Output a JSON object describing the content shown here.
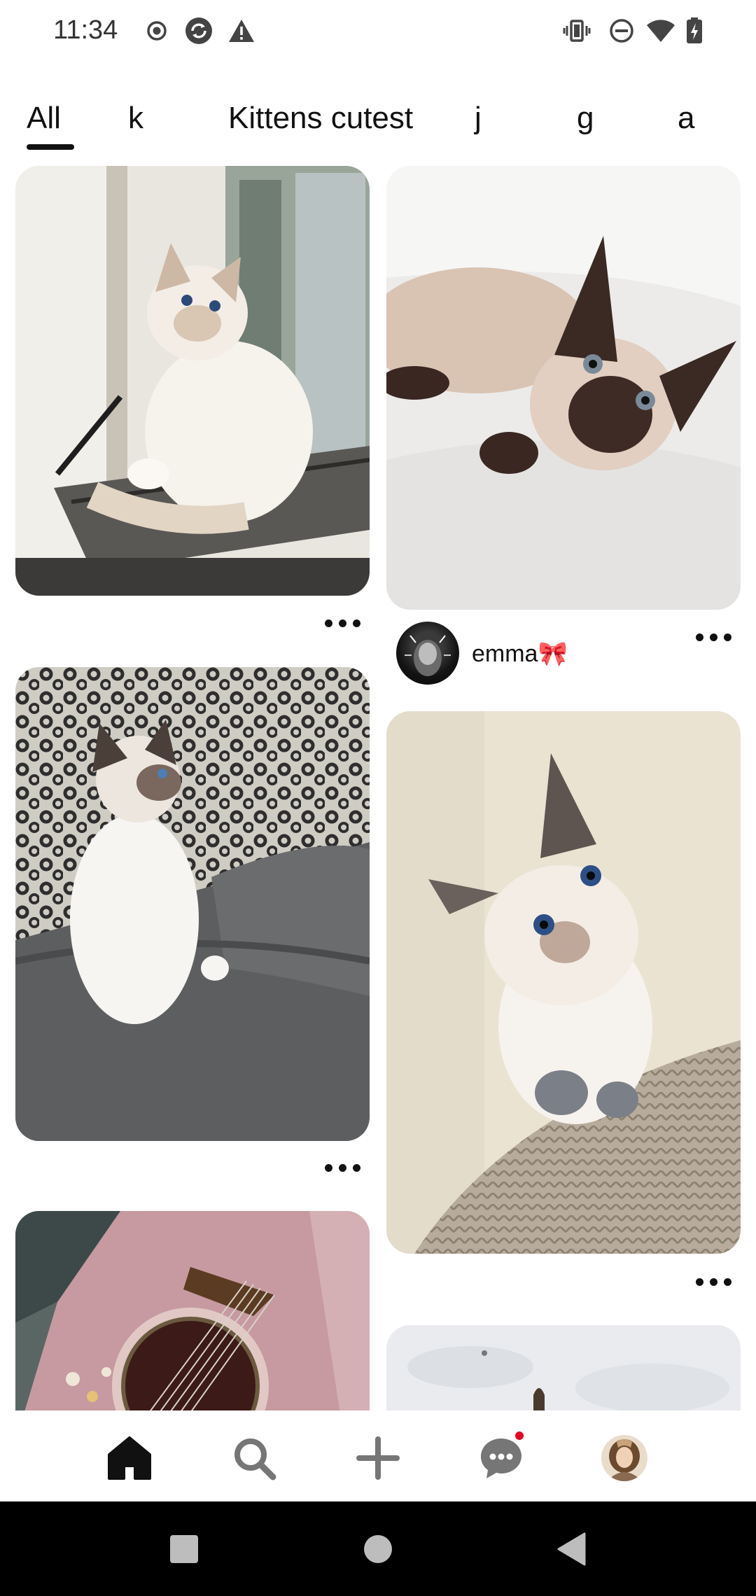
{
  "status_bar": {
    "time": "11:34",
    "left_icons": [
      "record-icon",
      "sync-icon",
      "warning-icon"
    ],
    "right_icons": [
      "vibrate-icon",
      "dnd-icon",
      "wifi-icon",
      "battery-charging-icon"
    ]
  },
  "tabs": {
    "items": [
      {
        "label": "All",
        "selected": true
      },
      {
        "label": "k",
        "selected": false
      },
      {
        "label": "Kittens cutest",
        "selected": false
      },
      {
        "label": "j",
        "selected": false
      },
      {
        "label": "g",
        "selected": false
      },
      {
        "label": "a",
        "selected": false
      }
    ]
  },
  "feed": {
    "pins": [
      {
        "column": "left",
        "subject": "ragdoll cat sitting on window perch",
        "has_more_menu": true
      },
      {
        "column": "right",
        "subject": "siamese kitten lying on white sheet",
        "creator": "emma🎀",
        "has_more_menu": true
      },
      {
        "column": "left",
        "subject": "fluffy kitten on grey couch",
        "has_more_menu": true
      },
      {
        "column": "right",
        "subject": "ragdoll kitten on knitted blanket",
        "has_more_menu": true
      },
      {
        "column": "left",
        "subject": "pink acoustic guitar",
        "has_more_menu": false
      },
      {
        "column": "right",
        "subject": "snowy scene",
        "has_more_menu": false
      }
    ]
  },
  "bottom_nav": {
    "items": [
      {
        "icon": "home-icon",
        "active": true
      },
      {
        "icon": "search-icon",
        "active": false
      },
      {
        "icon": "plus-icon",
        "active": false
      },
      {
        "icon": "messages-icon",
        "active": false,
        "notification_dot": true
      },
      {
        "icon": "profile-avatar",
        "active": false
      }
    ],
    "accent_color": "#e60023"
  },
  "system_nav": {
    "buttons": [
      "recents-square-icon",
      "home-circle-icon",
      "back-triangle-icon"
    ]
  }
}
